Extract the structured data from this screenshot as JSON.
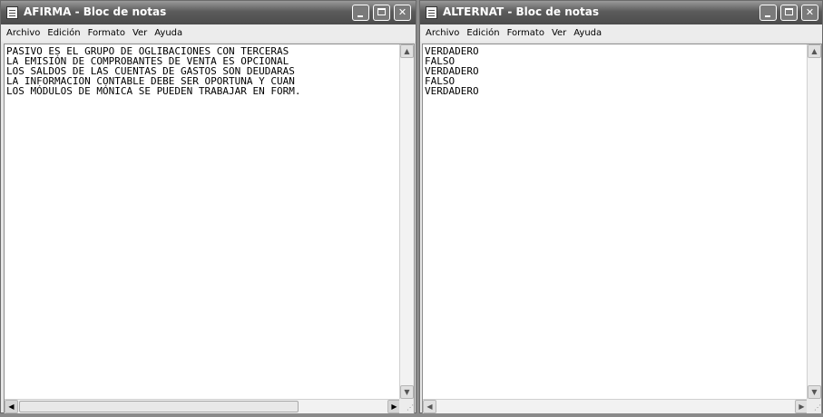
{
  "window_left": {
    "title": "AFIRMA - Bloc de notas",
    "menu": [
      "Archivo",
      "Edición",
      "Formato",
      "Ver",
      "Ayuda"
    ],
    "lines": [
      "PASIVO ES EL GRUPO DE OGLIBACIONES CON TERCERAS",
      "LA EMISIÓN DE COMPROBANTES DE VENTA ES OPCIONAL",
      "LOS SALDOS DE LAS CUENTAS DE GASTOS SON DEUDARAS",
      "LA INFORMACION CONTABLE DEBE SER OPORTUNA Y CUAN",
      "LOS MÓDULOS DE MÓNICA SE PUEDEN TRABAJAR EN FORM."
    ]
  },
  "window_right": {
    "title": "ALTERNAT - Bloc de notas",
    "menu": [
      "Archivo",
      "Edición",
      "Formato",
      "Ver",
      "Ayuda"
    ],
    "lines": [
      "VERDADERO",
      "FALSO",
      "VERDADERO",
      "FALSO",
      "VERDADERO"
    ]
  },
  "icons": {
    "minimize": "minimize-icon",
    "maximize": "maximize-icon",
    "close": "close-icon",
    "scroll_up": "scroll-up-arrow-icon",
    "scroll_down": "scroll-down-arrow-icon",
    "scroll_left": "scroll-left-arrow-icon",
    "scroll_right": "scroll-right-arrow-icon",
    "app": "notepad-icon"
  }
}
